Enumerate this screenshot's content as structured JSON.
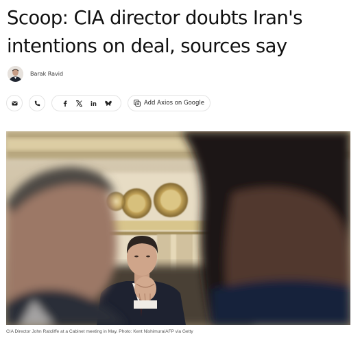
{
  "article": {
    "headline_line1": "Scoop: CIA director doubts Iran's",
    "headline_line2": "intentions on deal, sources say",
    "author": "Barak Ravid"
  },
  "share": {
    "buttons": [
      {
        "name": "email",
        "icon": "envelope-icon"
      },
      {
        "name": "phone",
        "icon": "phone-icon"
      },
      {
        "name": "facebook",
        "icon": "facebook-icon"
      },
      {
        "name": "x",
        "icon": "x-icon"
      },
      {
        "name": "linkedin",
        "icon": "linkedin-icon"
      },
      {
        "name": "bluesky",
        "icon": "bluesky-icon"
      }
    ],
    "google_label": "Add Axios on Google"
  },
  "photo": {
    "caption": "CIA Director John Ratcliffe at a Cabinet meeting in May. Photo: Kent Nishimura/AFP via Getty"
  },
  "colors": {
    "text": "#111111",
    "pill_border": "#e3e3e3"
  }
}
